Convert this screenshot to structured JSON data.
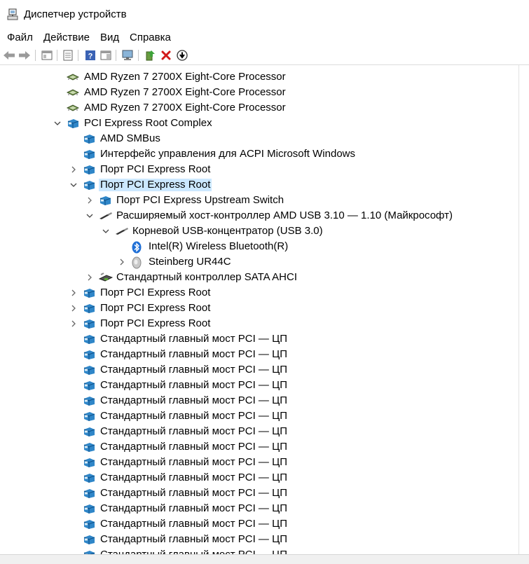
{
  "window": {
    "title": "Диспетчер устройств"
  },
  "menu": {
    "items": [
      "Файл",
      "Действие",
      "Вид",
      "Справка"
    ]
  },
  "toolbar": {
    "buttons": [
      "back-icon",
      "forward-icon",
      "properties-pane-icon",
      "console-tree-icon",
      "help-icon",
      "action-pane-icon",
      "monitor-icon",
      "update-driver-icon",
      "uninstall-icon",
      "download-icon"
    ]
  },
  "tree": {
    "rows": [
      {
        "label": "AMD Ryzen 7 2700X Eight-Core Processor",
        "level": 3,
        "icon": "cpu-icon",
        "expander": "none"
      },
      {
        "label": "AMD Ryzen 7 2700X Eight-Core Processor",
        "level": 3,
        "icon": "cpu-icon",
        "expander": "none"
      },
      {
        "label": "AMD Ryzen 7 2700X Eight-Core Processor",
        "level": 3,
        "icon": "cpu-icon",
        "expander": "none"
      },
      {
        "label": "PCI Express Root Complex",
        "level": 3,
        "icon": "pci-device-icon",
        "expander": "expanded"
      },
      {
        "label": "AMD SMBus",
        "level": 4,
        "icon": "pci-device-icon",
        "expander": "none"
      },
      {
        "label": "Интерфейс управления для ACPI Microsoft Windows",
        "level": 4,
        "icon": "pci-device-icon",
        "expander": "none"
      },
      {
        "label": "Порт PCI Express Root",
        "level": 4,
        "icon": "pci-device-icon",
        "expander": "collapsed"
      },
      {
        "label": "Порт PCI Express Root",
        "level": 4,
        "icon": "pci-device-icon",
        "expander": "expanded",
        "selected": true
      },
      {
        "label": "Порт PCI Express Upstream Switch",
        "level": 5,
        "icon": "pci-device-icon",
        "expander": "collapsed"
      },
      {
        "label": "Расширяемый хост-контроллер AMD USB 3.10 — 1.10 (Майкрософт)",
        "level": 5,
        "icon": "usb-icon",
        "expander": "expanded"
      },
      {
        "label": "Корневой USB-концентратор (USB 3.0)",
        "level": 6,
        "icon": "usb-icon",
        "expander": "expanded"
      },
      {
        "label": "Intel(R) Wireless Bluetooth(R)",
        "level": 7,
        "icon": "bluetooth-icon",
        "expander": "none"
      },
      {
        "label": "Steinberg UR44C",
        "level": 7,
        "icon": "audio-device-icon",
        "expander": "collapsed"
      },
      {
        "label": "Стандартный контроллер SATA AHCI",
        "level": 5,
        "icon": "storage-controller-icon",
        "expander": "collapsed"
      },
      {
        "label": "Порт PCI Express Root",
        "level": 4,
        "icon": "pci-device-icon",
        "expander": "collapsed"
      },
      {
        "label": "Порт PCI Express Root",
        "level": 4,
        "icon": "pci-device-icon",
        "expander": "collapsed"
      },
      {
        "label": "Порт PCI Express Root",
        "level": 4,
        "icon": "pci-device-icon",
        "expander": "collapsed"
      },
      {
        "label": "Стандартный главный мост PCI — ЦП",
        "level": 4,
        "icon": "pci-device-icon",
        "expander": "none"
      },
      {
        "label": "Стандартный главный мост PCI — ЦП",
        "level": 4,
        "icon": "pci-device-icon",
        "expander": "none"
      },
      {
        "label": "Стандартный главный мост PCI — ЦП",
        "level": 4,
        "icon": "pci-device-icon",
        "expander": "none"
      },
      {
        "label": "Стандартный главный мост PCI — ЦП",
        "level": 4,
        "icon": "pci-device-icon",
        "expander": "none"
      },
      {
        "label": "Стандартный главный мост PCI — ЦП",
        "level": 4,
        "icon": "pci-device-icon",
        "expander": "none"
      },
      {
        "label": "Стандартный главный мост PCI — ЦП",
        "level": 4,
        "icon": "pci-device-icon",
        "expander": "none"
      },
      {
        "label": "Стандартный главный мост PCI — ЦП",
        "level": 4,
        "icon": "pci-device-icon",
        "expander": "none"
      },
      {
        "label": "Стандартный главный мост PCI — ЦП",
        "level": 4,
        "icon": "pci-device-icon",
        "expander": "none"
      },
      {
        "label": "Стандартный главный мост PCI — ЦП",
        "level": 4,
        "icon": "pci-device-icon",
        "expander": "none"
      },
      {
        "label": "Стандартный главный мост PCI — ЦП",
        "level": 4,
        "icon": "pci-device-icon",
        "expander": "none"
      },
      {
        "label": "Стандартный главный мост PCI — ЦП",
        "level": 4,
        "icon": "pci-device-icon",
        "expander": "none"
      },
      {
        "label": "Стандартный главный мост PCI — ЦП",
        "level": 4,
        "icon": "pci-device-icon",
        "expander": "none"
      },
      {
        "label": "Стандартный главный мост PCI — ЦП",
        "level": 4,
        "icon": "pci-device-icon",
        "expander": "none"
      },
      {
        "label": "Стандартный главный мост PCI — ЦП",
        "level": 4,
        "icon": "pci-device-icon",
        "expander": "none"
      },
      {
        "label": "Стандартный главный мост PCI — ЦП",
        "level": 4,
        "icon": "pci-device-icon",
        "expander": "none"
      },
      {
        "label": "Стандартный главный мост PCI — ЦП",
        "level": 4,
        "icon": "pci-device-icon",
        "expander": "none"
      }
    ]
  },
  "colors": {
    "selection": "#cce8ff",
    "pci_icon_blue": "#2f86c8"
  }
}
